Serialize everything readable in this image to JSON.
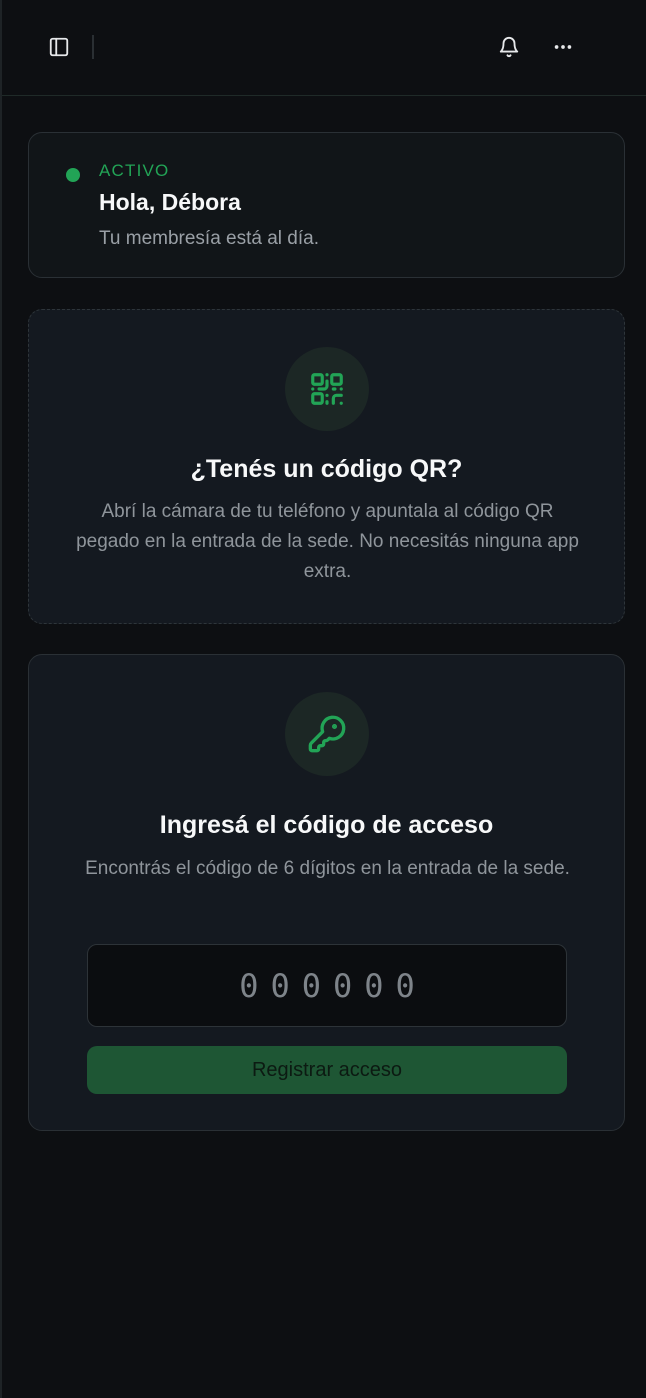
{
  "header": {
    "sidebar_icon": "sidebar-toggle-icon",
    "bell_icon": "bell-icon",
    "more_icon": "more-horizontal-icon"
  },
  "status": {
    "label": "ACTIVO",
    "greeting": "Hola, Débora",
    "subtitle": "Tu membresía está al día.",
    "dot_color": "#22a456"
  },
  "qr": {
    "icon": "qr-code-icon",
    "title": "¿Tenés un código QR?",
    "description": "Abrí la cámara de tu teléfono y apuntala al código QR pegado en la entrada de la sede. No necesitás ninguna app extra."
  },
  "access": {
    "icon": "key-icon",
    "title": "Ingresá el código de acceso",
    "description": "Encontrás el código de 6 dígitos en la entrada de la sede.",
    "input_placeholder": "000000",
    "input_value": "",
    "submit_label": "Registrar acceso"
  },
  "colors": {
    "accent": "#22a456",
    "button_bg": "#1e5634",
    "background": "#0d0f12"
  }
}
